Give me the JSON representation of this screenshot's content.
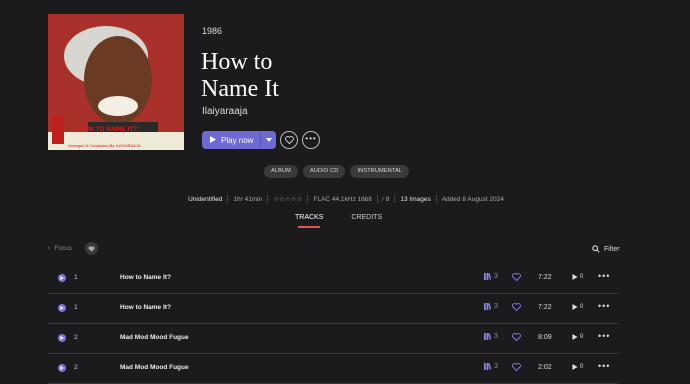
{
  "album": {
    "year": "1986",
    "title": "How to\nName It",
    "artist": "Ilaiyaraaja",
    "cover_text": "HOW TO NAME IT?",
    "cover_credit": "Arranged & Conducted By ILAIYARAAJA"
  },
  "actions": {
    "play_label": "Play now"
  },
  "tags": [
    "ALBUM",
    "AUDIO CD",
    "INSTRUMENTAL"
  ],
  "meta": {
    "source": "Unidentified",
    "duration": "1hr 41min",
    "rating": "☆☆☆☆☆",
    "format": "FLAC 44.1kHz 16bit",
    "count": "8",
    "images": "13 Images",
    "added": "Added 8 August 2024"
  },
  "tabs": [
    {
      "label": "TRACKS",
      "active": true
    },
    {
      "label": "CREDITS",
      "active": false
    }
  ],
  "toolbar": {
    "focus_label": "Focus",
    "filter_label": "Filter"
  },
  "tracks": [
    {
      "disc": "1",
      "title": "How to Name It?",
      "versions": "3",
      "duration": "7:22",
      "plays": "0"
    },
    {
      "disc": "1",
      "title": "How to Name It?",
      "versions": "3",
      "duration": "7:22",
      "plays": "0"
    },
    {
      "disc": "2",
      "title": "Mad Mod Mood Fugue",
      "versions": "3",
      "duration": "8:09",
      "plays": "0"
    },
    {
      "disc": "2",
      "title": "Mad Mod Mood Fugue",
      "versions": "3",
      "duration": "2:02",
      "plays": "0"
    }
  ],
  "colors": {
    "accent": "#6e6ad3",
    "tab_underline": "#e2574c",
    "background": "#1b1b1d"
  }
}
